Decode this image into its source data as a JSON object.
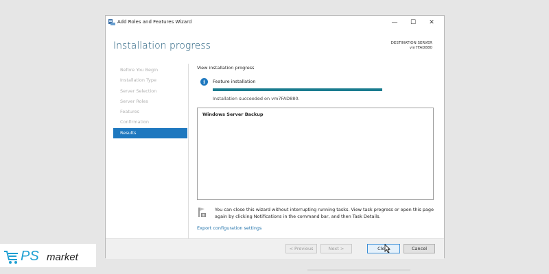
{
  "window": {
    "title": "Add Roles and Features Wizard",
    "controls": {
      "minimize": "—",
      "maximize": "☐",
      "close": "✕"
    }
  },
  "header": {
    "page_title": "Installation progress",
    "destination_label": "DESTINATION SERVER",
    "destination_value": "vm7FAD880"
  },
  "sidebar": {
    "items": [
      {
        "label": "Before You Begin",
        "active": false
      },
      {
        "label": "Installation Type",
        "active": false
      },
      {
        "label": "Server Selection",
        "active": false
      },
      {
        "label": "Server Roles",
        "active": false
      },
      {
        "label": "Features",
        "active": false
      },
      {
        "label": "Confirmation",
        "active": false
      },
      {
        "label": "Results",
        "active": true
      }
    ]
  },
  "content": {
    "section_label": "View installation progress",
    "info_icon": "i",
    "feature_label": "Feature installation",
    "progress_fraction": 1.0,
    "success_text": "Installation succeeded on vm7FAD880.",
    "results": [
      "Windows Server Backup"
    ],
    "note": "You can close this wizard without interrupting running tasks. View task progress or open this page again by clicking Notifications in the command bar, and then Task Details.",
    "export_link": "Export configuration settings"
  },
  "buttons": {
    "previous": "< Previous",
    "next": "Next >",
    "close": "Close",
    "cancel": "Cancel"
  },
  "watermark": {
    "logo_ps": "PS",
    "logo_market": "market"
  },
  "colors": {
    "accent": "#1e78bf",
    "progress": "#1a7c8f",
    "title": "#1e5a7a",
    "link": "#1a6ea8"
  }
}
